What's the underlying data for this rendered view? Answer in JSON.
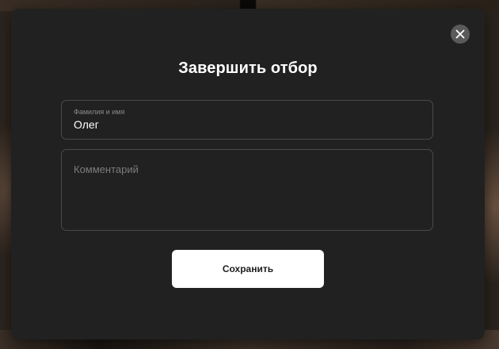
{
  "modal": {
    "title": "Завершить отбор",
    "close_icon": "close-icon",
    "name_field": {
      "label": "Фамилия и имя",
      "value": "Олег"
    },
    "comment_field": {
      "placeholder": "Комментарий",
      "value": ""
    },
    "save_label": "Сохранить"
  },
  "colors": {
    "modal_bg": "#212121",
    "field_border": "#4a4a4a",
    "close_bg": "#5a5a5a",
    "primary_button_bg": "#ffffff",
    "primary_button_text": "#1d1d1d"
  }
}
